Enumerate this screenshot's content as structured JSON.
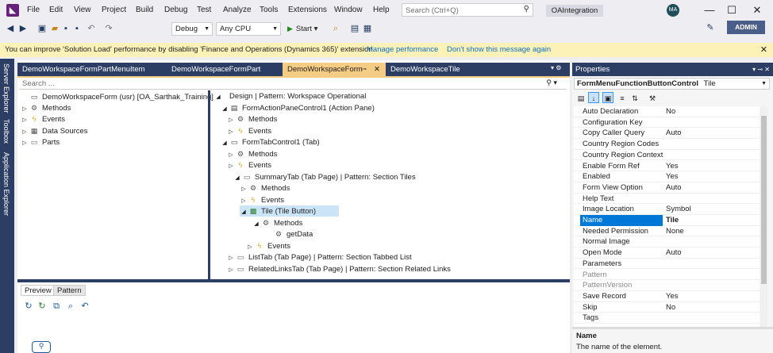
{
  "menu": {
    "logo": "◣",
    "items": [
      "File",
      "Edit",
      "View",
      "Project",
      "Build",
      "Debug",
      "Test",
      "Analyze",
      "Tools",
      "Extensions",
      "Window",
      "Help"
    ],
    "search_placeholder": "Search (Ctrl+Q)",
    "solution": "OAIntegration",
    "user_initials": "MA",
    "minimize": "—",
    "maximize": "☐",
    "close": "✕"
  },
  "toolbar": {
    "config": "Debug",
    "platform": "Any CPU",
    "start": "Start",
    "admin": "ADMIN"
  },
  "infobar": {
    "message": "You can improve 'Solution Load' performance by disabling 'Finance and Operations (Dynamics 365)' extension.",
    "link1": "Manage performance",
    "link2": "Don't show this message again",
    "close": "✕"
  },
  "side_strip": [
    "Server Explorer",
    "Toolbox",
    "Application Explorer"
  ],
  "tabs": [
    {
      "label": "DemoWorkspaceFormPartMenuItem"
    },
    {
      "label": "DemoWorkspaceFormPart"
    },
    {
      "label": "DemoWorkspaceForm"
    },
    {
      "label": "DemoWorkspaceTile"
    }
  ],
  "editor": {
    "search_placeholder": "Search ...",
    "left_tree": [
      {
        "label": "DemoWorkspaceForm (usr) [OA_Sarthak_Training]",
        "icon": "form",
        "twisty": ""
      },
      {
        "label": "Methods",
        "icon": "gear",
        "twisty": "▷"
      },
      {
        "label": "Events",
        "icon": "bolt",
        "twisty": "▷"
      },
      {
        "label": "Data Sources",
        "icon": "db",
        "twisty": "▷"
      },
      {
        "label": "Parts",
        "icon": "folder",
        "twisty": "▷"
      }
    ],
    "right_tree": [
      {
        "label": "Design | Pattern: Workspace Operational",
        "icon": "",
        "twisty": "◢",
        "indent": 0
      },
      {
        "label": "FormActionPaneControl1 (Action Pane)",
        "icon": "pane",
        "twisty": "◢",
        "indent": 1
      },
      {
        "label": "Methods",
        "icon": "gear",
        "twisty": "▷",
        "indent": 2
      },
      {
        "label": "Events",
        "icon": "bolt",
        "twisty": "▷",
        "indent": 2
      },
      {
        "label": "FormTabControl1 (Tab)",
        "icon": "tab",
        "twisty": "◢",
        "indent": 1
      },
      {
        "label": "Methods",
        "icon": "gear",
        "twisty": "▷",
        "indent": 2
      },
      {
        "label": "Events",
        "icon": "bolt",
        "twisty": "▷",
        "indent": 2
      },
      {
        "label": "SummaryTab (Tab Page) | Pattern: Section Tiles",
        "icon": "page",
        "twisty": "◢",
        "indent": 2
      },
      {
        "label": "Methods",
        "icon": "gear",
        "twisty": "▷",
        "indent": 3
      },
      {
        "label": "Events",
        "icon": "bolt",
        "twisty": "▷",
        "indent": 3
      },
      {
        "label": "Tile (Tile Button)",
        "icon": "tile",
        "twisty": "◢",
        "indent": 3
      },
      {
        "label": "Methods",
        "icon": "gear",
        "twisty": "◢",
        "indent": 4
      },
      {
        "label": "getData",
        "icon": "method",
        "twisty": "",
        "indent": 5
      },
      {
        "label": "Events",
        "icon": "bolt",
        "twisty": "▷",
        "indent": 4
      },
      {
        "label": "ListTab (Tab Page) | Pattern: Section Tabbed List",
        "icon": "page",
        "twisty": "▷",
        "indent": 2
      },
      {
        "label": "RelatedLinksTab (Tab Page) | Pattern: Section Related Links",
        "icon": "page",
        "twisty": "▷",
        "indent": 2
      }
    ]
  },
  "preview": {
    "tabs": [
      "Preview",
      "Pattern"
    ]
  },
  "properties": {
    "title": "Properties",
    "object_type": "FormMenuFunctionButtonControl",
    "object_name": "Tile",
    "rows": [
      {
        "name": "Auto Declaration",
        "value": "No"
      },
      {
        "name": "Configuration Key",
        "value": ""
      },
      {
        "name": "Copy Caller Query",
        "value": "Auto"
      },
      {
        "name": "Country Region Codes",
        "value": ""
      },
      {
        "name": "Country Region Context F",
        "value": ""
      },
      {
        "name": "Enable Form Ref",
        "value": "Yes"
      },
      {
        "name": "Enabled",
        "value": "Yes"
      },
      {
        "name": "Form View Option",
        "value": "Auto"
      },
      {
        "name": "Help Text",
        "value": ""
      },
      {
        "name": "Image Location",
        "value": "Symbol"
      },
      {
        "name": "Name",
        "value": "Tile",
        "selected": true
      },
      {
        "name": "Needed Permission",
        "value": "None"
      },
      {
        "name": "Normal Image",
        "value": ""
      },
      {
        "name": "Open Mode",
        "value": "Auto"
      },
      {
        "name": "Parameters",
        "value": ""
      },
      {
        "name": "Pattern",
        "value": "",
        "disabled": true
      },
      {
        "name": "PatternVersion",
        "value": "",
        "disabled": true
      },
      {
        "name": "Save Record",
        "value": "Yes"
      },
      {
        "name": "Skip",
        "value": "No"
      },
      {
        "name": "Tags",
        "value": ""
      }
    ],
    "desc_name": "Name",
    "desc_text": "The name of the element."
  }
}
